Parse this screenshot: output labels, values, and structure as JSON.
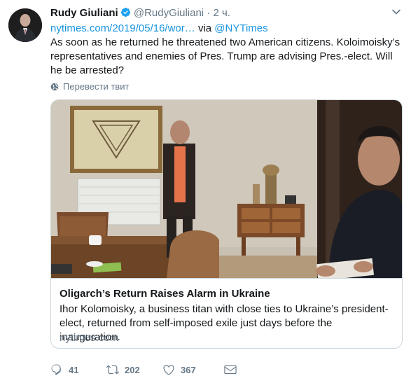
{
  "author": {
    "name": "Rudy Giuliani",
    "handle": "@RudyGiuliani",
    "separator": "·",
    "time": "2 ч."
  },
  "link_line": {
    "url": "nytimes.com/2019/05/16/wor…",
    "via": "via",
    "source": "@NYTimes"
  },
  "tweet_text": "As soon as he returned he threatened two American citizens. Koloimoisky’s representatives and enemies of Pres. Trump are advising Pres.-elect. Will he be arrested?",
  "translate_label": "Перевести твит",
  "card": {
    "title": "Oligarch’s Return Raises Alarm in Ukraine",
    "description": "Ihor Kolomoisky, a business titan with close ties to Ukraine’s president-elect, returned from self-imposed exile just days before the inauguration.",
    "domain": "nytimes.com"
  },
  "actions": {
    "reply_count": "41",
    "retweet_count": "202",
    "like_count": "367"
  },
  "colors": {
    "link": "#1b95e0",
    "secondary_text": "#657786",
    "border": "#ccd6dd",
    "verified": "#1da1f2"
  },
  "icons": [
    "verified-badge-icon",
    "chevron-down-icon",
    "globe-icon",
    "reply-icon",
    "retweet-icon",
    "like-icon",
    "dm-icon"
  ]
}
